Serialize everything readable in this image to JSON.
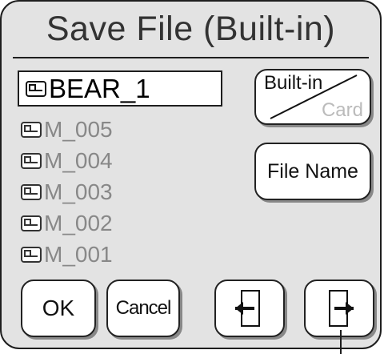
{
  "title": "Save File (Built-in)",
  "current_file": "BEAR_1",
  "files": [
    "M_005",
    "M_004",
    "M_003",
    "M_002",
    "M_001"
  ],
  "storage_toggle": {
    "top": "Built-in",
    "bottom": "Card"
  },
  "buttons": {
    "file_name": "File Name",
    "ok": "OK",
    "cancel": "Cancel"
  },
  "icons": {
    "file": "file-icon",
    "prev": "page-prev-arrow-icon",
    "next": "page-next-arrow-icon"
  }
}
